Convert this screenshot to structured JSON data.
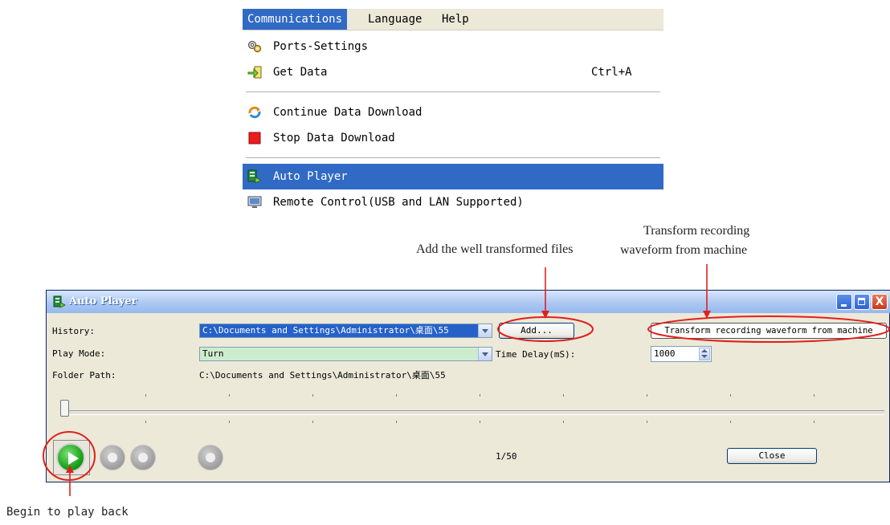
{
  "menu": {
    "bar": [
      "Communications",
      "Language",
      "Help"
    ],
    "items": [
      {
        "label": "Ports-Settings",
        "icon": "gear-ports-icon",
        "shortcut": ""
      },
      {
        "label": "Get Data",
        "icon": "get-data-icon",
        "shortcut": "Ctrl+A"
      },
      {
        "label": "Continue Data Download",
        "icon": "continue-download-icon",
        "shortcut": ""
      },
      {
        "label": "Stop Data Download",
        "icon": "stop-icon",
        "shortcut": ""
      },
      {
        "label": "Auto Player",
        "icon": "auto-player-icon",
        "shortcut": ""
      },
      {
        "label": "Remote Control(USB and LAN Supported)",
        "icon": "remote-control-icon",
        "shortcut": ""
      }
    ]
  },
  "annotations": {
    "add_files": "Add the well transformed files",
    "transform_line1": "Transform recording",
    "transform_line2": "waveform from machine",
    "begin": "Begin to play back"
  },
  "window": {
    "title": "Auto Player",
    "close_x": "X",
    "history_label": "History:",
    "history_value": "C:\\Documents and Settings\\Administrator\\桌面\\55",
    "add_button": "Add...",
    "transform_button": "Transform recording waveform from machine",
    "play_mode_label": "Play Mode:",
    "play_mode_value": "Turn",
    "time_delay_label": "Time Delay(mS):",
    "time_delay_value": "1000",
    "folder_path_label": "Folder Path:",
    "folder_path_value": "C:\\Documents and Settings\\Administrator\\桌面\\55",
    "counter": "1/50",
    "close_button": "Close",
    "progress_fraction": 0
  },
  "colors": {
    "menu_highlight": "#316ac5",
    "annotation_red": "#e02020",
    "play_green": "#1ba41c"
  }
}
